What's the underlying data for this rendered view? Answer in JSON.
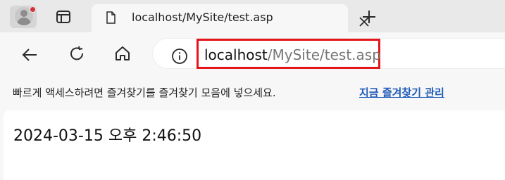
{
  "tab": {
    "title": "localhost/MySite/test.asp"
  },
  "toolbar": {
    "url_host": "localhost",
    "url_path": "/MySite/test.asp"
  },
  "favorites_bar": {
    "message": "빠르게 액세스하려면 즐겨찾기를 즐겨찾기 모음에 넣으세요.",
    "link": "지금 즐겨찾기 관리"
  },
  "page": {
    "content": "2024-03-15 오후 2:46:50"
  },
  "colors": {
    "highlight": "#e4141b",
    "link": "#1e5bb8",
    "notification_dot": "#d13438"
  },
  "icons": {
    "profile": "profile-avatar-icon",
    "tab_actions": "tab-actions-icon",
    "page": "page-icon",
    "close": "close-icon",
    "new_tab": "plus-icon",
    "back": "back-arrow-icon",
    "reload": "reload-icon",
    "home": "home-icon",
    "info": "info-icon"
  }
}
